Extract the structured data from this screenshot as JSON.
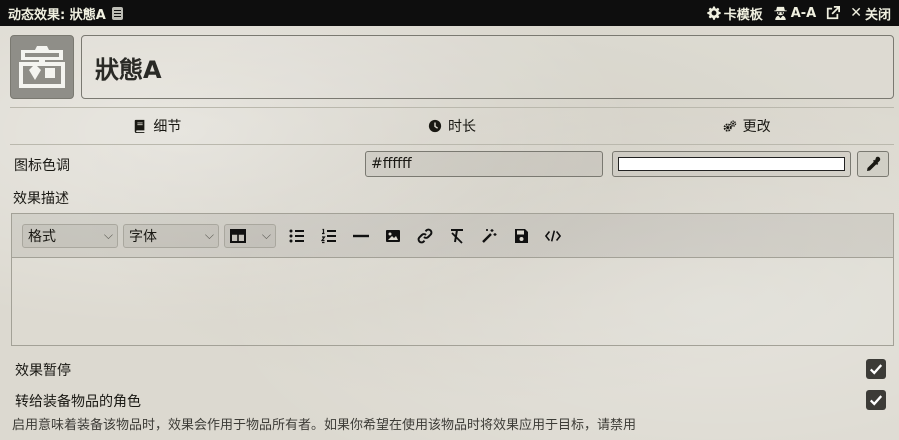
{
  "header": {
    "title": "动态效果: 狀態A",
    "doc_icon": "document-icon",
    "controls": [
      {
        "label": "卡模板",
        "icon": "gear-icon"
      },
      {
        "label": "A-A",
        "icon": "user-secret-icon"
      },
      {
        "label": "",
        "icon": "external-link-icon"
      },
      {
        "label": "关闭",
        "icon": "close-icon"
      }
    ]
  },
  "effect": {
    "name": "狀態A",
    "image_icon": "treasure-chest-icon"
  },
  "tabs": [
    {
      "label": "细节",
      "icon": "book-icon"
    },
    {
      "label": "时长",
      "icon": "clock-icon"
    },
    {
      "label": "更改",
      "icon": "cogs-icon"
    }
  ],
  "details": {
    "tint_label": "图标色调",
    "tint_value": "#ffffff",
    "tint_color": "#ffffff",
    "description_label": "效果描述",
    "editor": {
      "format_label": "格式",
      "font_label": "字体",
      "body": ""
    },
    "suspended_label": "效果暂停",
    "suspended_checked": true,
    "transfer_label": "转给装备物品的角色",
    "transfer_checked": true,
    "transfer_hint": "启用意味着装备该物品时，效果会作用于物品所有者。如果你希望在使用该物品时将效果应用于目标，请禁用"
  },
  "colors": {
    "header_bg": "#0e0e0e",
    "parchment": "#dcd9d0",
    "checkbox": "#3c3b37"
  }
}
